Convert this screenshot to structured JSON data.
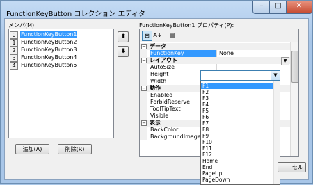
{
  "window": {
    "title": "FunctionKeyButton コレクション エディタ",
    "close_glyph": "✕",
    "min_glyph": "–",
    "max_glyph": "□"
  },
  "members": {
    "label": "メンバ(M):",
    "items": [
      {
        "index": "0",
        "name": "FunctionKeyButton1",
        "selected": true
      },
      {
        "index": "1",
        "name": "FunctionKeyButton2",
        "selected": false
      },
      {
        "index": "2",
        "name": "FunctionKeyButton3",
        "selected": false
      },
      {
        "index": "3",
        "name": "FunctionKeyButton4",
        "selected": false
      },
      {
        "index": "4",
        "name": "FunctionKeyButton5",
        "selected": false
      }
    ],
    "move_up_glyph": "⬆",
    "move_down_glyph": "⬇",
    "add_label": "追加(A)",
    "remove_label": "削除(R)"
  },
  "properties": {
    "label": "FunctionKeyButton1 プロパティ(P):",
    "toolbar": {
      "categorized_glyph": "⊞",
      "alphabetical_glyph": "A↓",
      "pages_glyph": "▤"
    },
    "rows": [
      {
        "type": "category",
        "name": "データ",
        "toggle": "−"
      },
      {
        "type": "prop",
        "name": "FunctionKey",
        "value": "None",
        "selected": true
      },
      {
        "type": "category",
        "name": "レイアウト",
        "toggle": "−"
      },
      {
        "type": "prop",
        "name": "AutoSize",
        "value": ""
      },
      {
        "type": "prop",
        "name": "Height",
        "value": ""
      },
      {
        "type": "prop",
        "name": "Width",
        "value": ""
      },
      {
        "type": "category",
        "name": "動作",
        "toggle": "−"
      },
      {
        "type": "prop",
        "name": "Enabled",
        "value": ""
      },
      {
        "type": "prop",
        "name": "ForbidReserve",
        "value": ""
      },
      {
        "type": "prop",
        "name": "ToolTipText",
        "value": ""
      },
      {
        "type": "prop",
        "name": "Visible",
        "value": ""
      },
      {
        "type": "category",
        "name": "表示",
        "toggle": "−"
      },
      {
        "type": "prop",
        "name": "BackColor",
        "value": ""
      },
      {
        "type": "prop",
        "name": "BackgroundImage",
        "value": ""
      }
    ]
  },
  "dropdown": {
    "combo_value": "",
    "arrow_glyph": "▼",
    "options": [
      "F1",
      "F2",
      "F3",
      "F4",
      "F5",
      "F6",
      "F7",
      "F8",
      "F9",
      "F10",
      "F11",
      "F12",
      "Home",
      "End",
      "PageUp",
      "PageDown"
    ],
    "selected": "F1"
  },
  "footer": {
    "cancel_label": "セル"
  }
}
